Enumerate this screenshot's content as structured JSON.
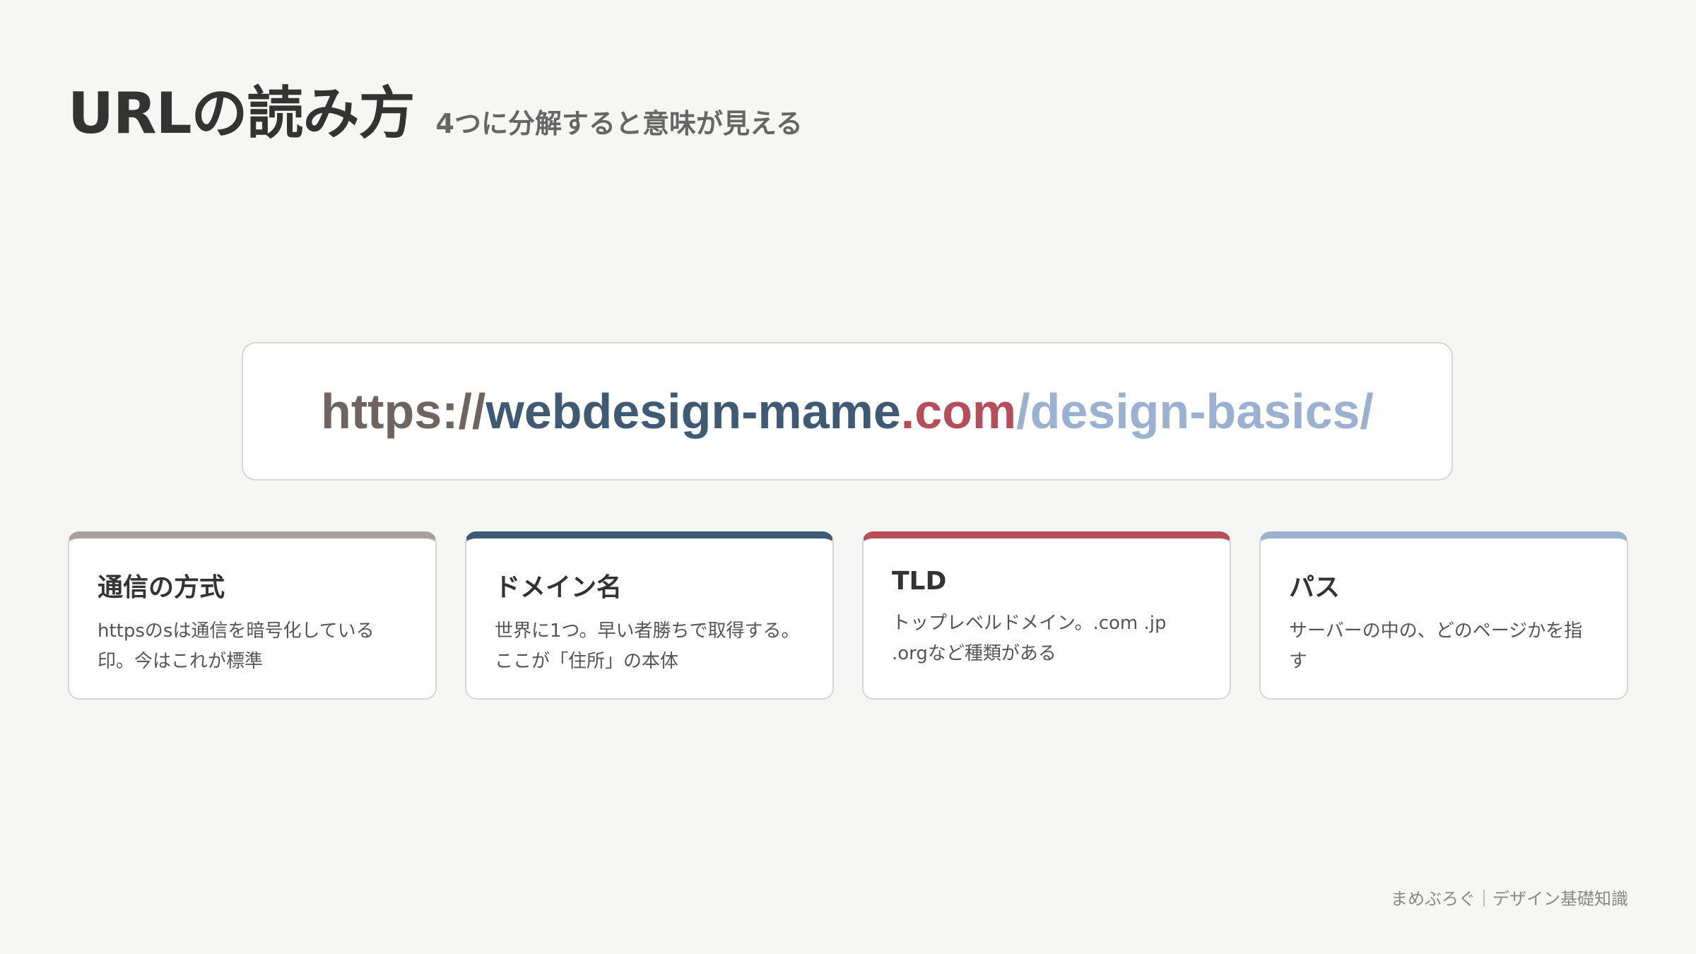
{
  "header": {
    "title": "URLの読み方",
    "subtitle": "4つに分解すると意味が見える"
  },
  "url": {
    "parts": [
      {
        "text": "https://",
        "color": "#6e6462"
      },
      {
        "text": "webdesign-mame",
        "color": "#3f5a75"
      },
      {
        "text": ".com",
        "color": "#b84d5a"
      },
      {
        "text": "/design-basics/",
        "color": "#9ab1d1"
      }
    ]
  },
  "cards": [
    {
      "title": "通信の方式",
      "desc": "httpsのsは通信を暗号化している印。今はこれが標準",
      "color": "#a8a09e"
    },
    {
      "title": "ドメイン名",
      "desc": "世界に1つ。早い者勝ちで取得する。ここが「住所」の本体",
      "color": "#3f5a75"
    },
    {
      "title": "TLD",
      "desc": "トップレベルドメイン。.com .jp .orgなど種類がある",
      "color": "#b84d5a"
    },
    {
      "title": "パス",
      "desc": "サーバーの中の、どのページかを指す",
      "color": "#9ab1d1"
    }
  ],
  "footer": {
    "text": "まめぶろぐ｜デザイン基礎知識"
  }
}
